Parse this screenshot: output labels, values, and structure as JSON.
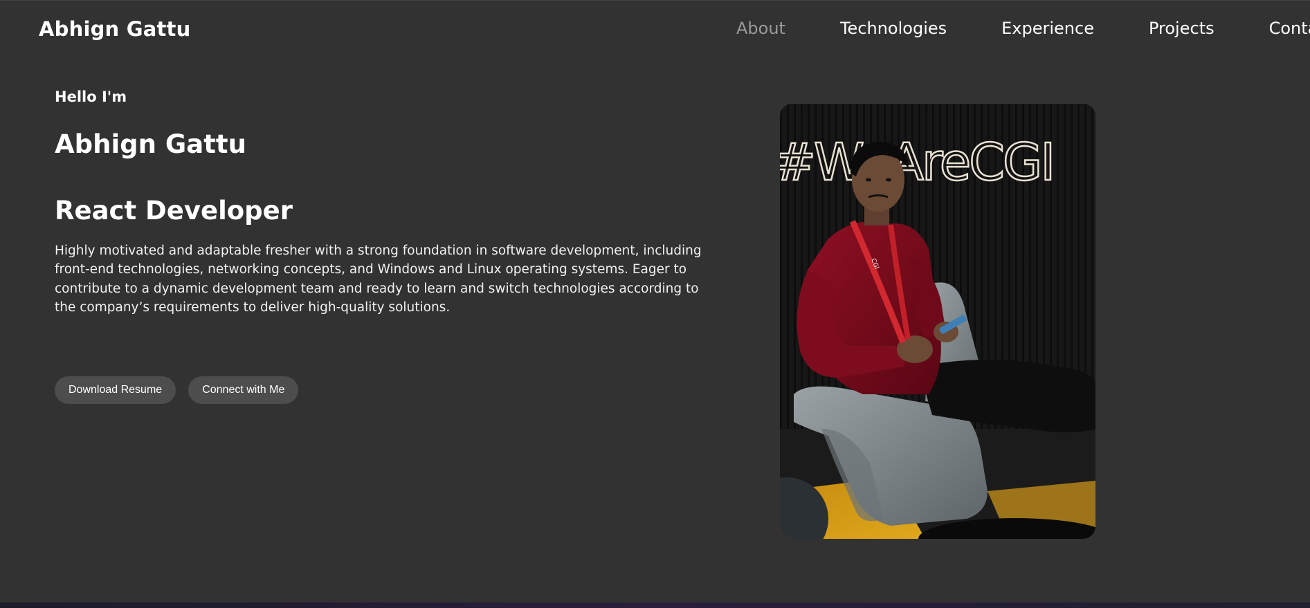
{
  "header": {
    "brand": "Abhign Gattu",
    "nav": [
      {
        "label": "About",
        "active": true
      },
      {
        "label": "Technologies",
        "active": false
      },
      {
        "label": "Experience",
        "active": false
      },
      {
        "label": "Projects",
        "active": false
      },
      {
        "label": "Contact",
        "active": false
      }
    ]
  },
  "hero": {
    "greeting": "Hello I'm",
    "name": "Abhign Gattu",
    "role": "React Developer",
    "bio": "Highly motivated and adaptable fresher with a strong foundation in software development, including front-end technologies, networking concepts, and Windows and Linux operating systems. Eager to contribute to a dynamic development team and ready to learn and switch technologies according to the company’s requirements to deliver high-quality solutions.",
    "buttons": {
      "resume": "Download Resume",
      "connect": "Connect with Me"
    }
  },
  "portrait": {
    "sign_text": "#WeAreCGI",
    "lanyard_text": "CGI"
  },
  "colors": {
    "background": "#323232",
    "nav_active": "#9a9a9a",
    "button_bg": "#4d4d4d"
  }
}
